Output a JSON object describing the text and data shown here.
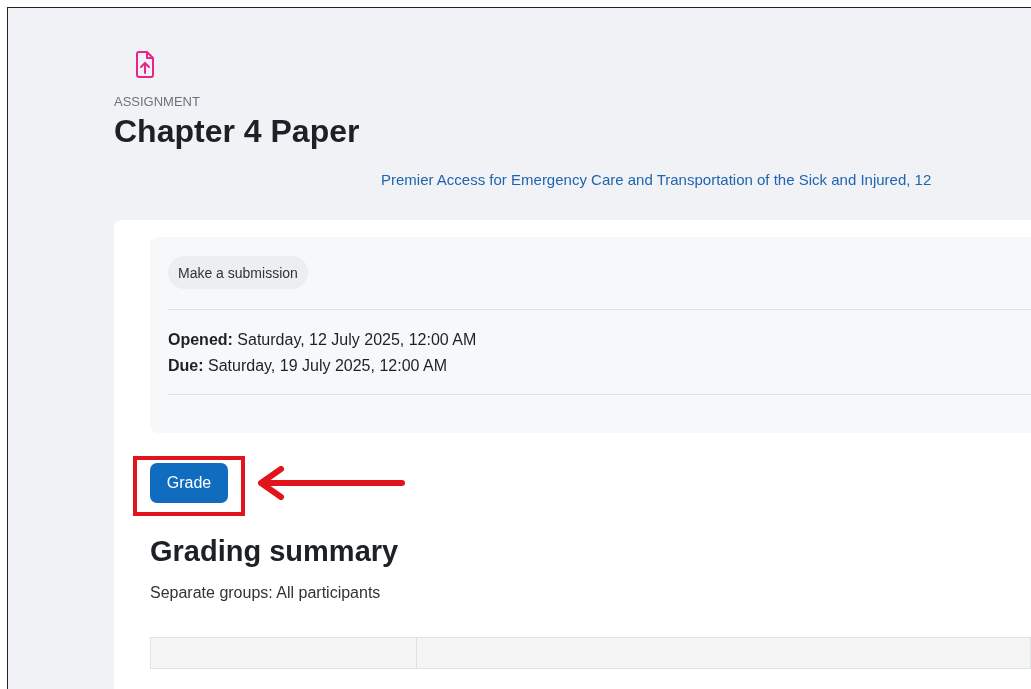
{
  "header": {
    "kind_label": "ASSIGNMENT",
    "title": "Chapter 4 Paper",
    "course_link": "Premier Access for Emergency Care and Transportation of the Sick and Injured, 12"
  },
  "activity": {
    "submission_button": "Make a submission",
    "dates": [
      {
        "label": "Opened:",
        "value": "Saturday, 12 July 2025, 12:00 AM"
      },
      {
        "label": "Due:",
        "value": "Saturday, 19 July 2025, 12:00 AM"
      }
    ]
  },
  "grade_button": "Grade",
  "grading_summary": {
    "title": "Grading summary",
    "group_mode": "Separate groups: All participants"
  }
}
